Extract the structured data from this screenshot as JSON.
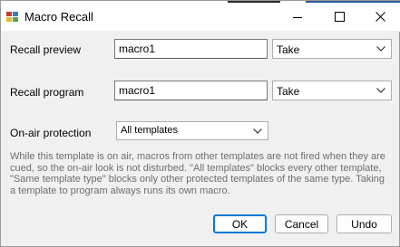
{
  "window": {
    "title": "Macro Recall",
    "icon": "app-icon"
  },
  "titlebar_buttons": [
    "minimize-icon",
    "maximize-icon",
    "close-icon"
  ],
  "rows": [
    {
      "label": "Recall preview",
      "macro_value": "macro1",
      "action": "Take"
    },
    {
      "label": "Recall program",
      "macro_value": "macro1",
      "action": "Take"
    }
  ],
  "protection": {
    "label": "On-air protection",
    "selected": "All templates"
  },
  "description": "While this template is on air, macros from other templates are not fired when they are cued, so the on-air look is not disturbed. \"All templates\" blocks every other template, \"Same template type\" blocks only other protected templates of the same type. Taking a template to program always runs its own macro.",
  "buttons": {
    "ok": "OK",
    "cancel": "Cancel",
    "undo": "Undo"
  },
  "colors": {
    "accent": "#0078d7",
    "window_bg": "#f0f0f0",
    "description_text": "#6d6d6d"
  }
}
